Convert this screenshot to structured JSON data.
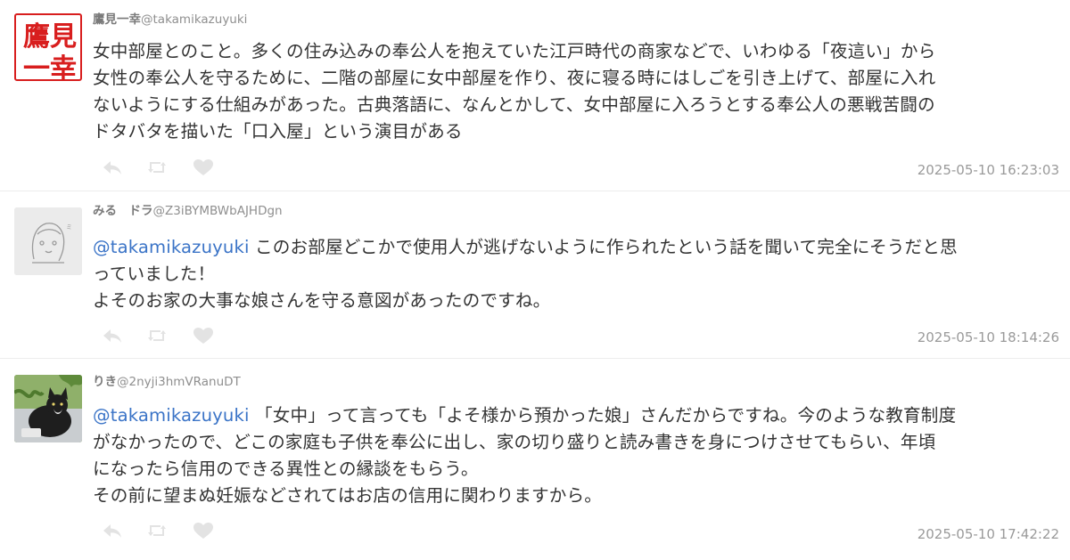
{
  "posts": [
    {
      "display_name": "鷹見一幸",
      "username": "@takamikazuyuki",
      "avatar_text": [
        "鷹見",
        "一幸"
      ],
      "mention": "",
      "lines": [
        "女中部屋とのこと。多くの住み込みの奉公人を抱えていた江戸時代の商家などで、いわゆる「夜這い」から",
        "女性の奉公人を守るために、二階の部屋に女中部屋を作り、夜に寝る時にはしごを引き上げて、部屋に入れ",
        "ないようにする仕組みがあった。古典落語に、なんとかして、女中部屋に入ろうとする奉公人の悪戦苦闘の",
        "ドタバタを描いた「口入屋」という演目がある"
      ],
      "timestamp": "2025-05-10 16:23:03"
    },
    {
      "display_name": "みる　ドラ",
      "username": "@Z3iBYMBWbAJHDgn",
      "avatar_text": [],
      "mention": "@takamikazuyuki",
      "lines": [
        " このお部屋どこかで使用人が逃げないように作られたという話を聞いて完全にそうだと思",
        "っていました！",
        "よそのお家の大事な娘さんを守る意図があったのですね。"
      ],
      "timestamp": "2025-05-10 18:14:26"
    },
    {
      "display_name": "りき",
      "username": "@2nyji3hmVRanuDT",
      "avatar_text": [],
      "mention": "@takamikazuyuki",
      "lines": [
        " 「女中」って言っても「よそ様から預かった娘」さんだからですね。今のような教育制度",
        "がなかったので、どこの家庭も子供を奉公に出し、家の切り盛りと読み書きを身につけさせてもらい、年頃",
        "になったら信用のできる異性との縁談をもらう。",
        "その前に望まぬ妊娠などされてはお店の信用に関わりますから。"
      ],
      "timestamp": "2025-05-10 17:42:22"
    }
  ],
  "icons": {
    "reply": "reply-arrow-icon",
    "retweet": "retweet-icon",
    "like": "heart-icon"
  },
  "colors": {
    "mention": "#3b74c7",
    "icon": "#e3e3e3",
    "timestamp": "#9a9a9a",
    "avatar_red": "#d81e1e"
  }
}
